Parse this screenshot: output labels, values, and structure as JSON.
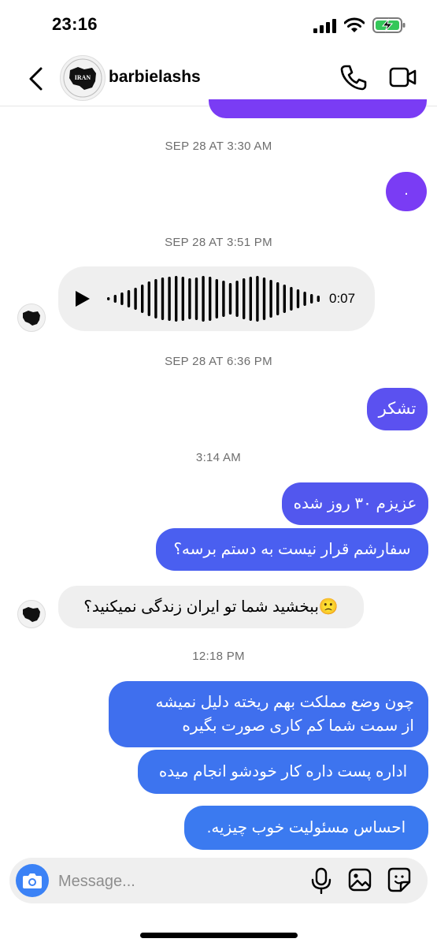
{
  "status_bar": {
    "time": "23:16"
  },
  "header": {
    "username": "barbielashs",
    "avatar_text": "IRAN"
  },
  "timestamps": {
    "t1": "SEP 28 AT 3:30 AM",
    "t2": "SEP 28 AT 3:51 PM",
    "t3": "SEP 28 AT 6:36 PM",
    "t4": "3:14 AM",
    "t5": "12:18 PM"
  },
  "messages": {
    "m1_dot": ".",
    "voice_duration": "0:07",
    "m2": "تشکر",
    "m3": "عزیزم ۳۰ روز شده",
    "m4": "سفارشم قرار نیست به دستم برسه؟",
    "m5": "🙁ببخشید شما تو ایران زندگی نمیکنید؟",
    "m6_line1": "چون وضع مملکت بهم ریخته دلیل نمیشه",
    "m6_line2": "از سمت شما کم کاری صورت بگیره",
    "m7": "اداره پست داره کار خودشو انجام میده",
    "m8": "احساس مسئولیت خوب چیزیه."
  },
  "composer": {
    "placeholder": "Message..."
  },
  "colors": {
    "violet": "#7a3cf4",
    "indigo": "#5b51f0",
    "blue": "#3f6fee",
    "sky": "#3b7af0",
    "camera": "#3b82f6"
  },
  "icons": [
    "back-arrow-icon",
    "phone-icon",
    "video-camera-icon",
    "play-icon",
    "camera-icon",
    "microphone-icon",
    "gallery-icon",
    "sticker-icon"
  ]
}
